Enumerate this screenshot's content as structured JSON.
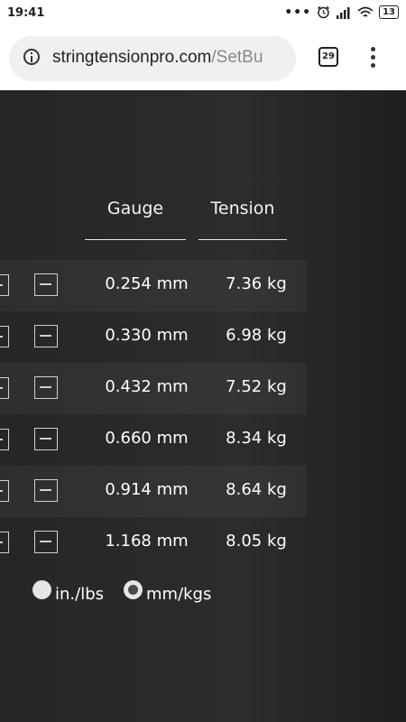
{
  "status_bar": {
    "time": "19:41",
    "battery": "13"
  },
  "browser": {
    "url_domain": "stringtensionpro.com",
    "url_path": "/SetBu",
    "tabs_count": "29"
  },
  "table": {
    "headers": {
      "gauge": "Gauge",
      "tension": "Tension"
    },
    "rows": [
      {
        "gauge": "0.254 mm",
        "tension": "7.36 kg"
      },
      {
        "gauge": "0.330 mm",
        "tension": "6.98 kg"
      },
      {
        "gauge": "0.432 mm",
        "tension": "7.52 kg"
      },
      {
        "gauge": "0.660 mm",
        "tension": "8.34 kg"
      },
      {
        "gauge": "0.914 mm",
        "tension": "8.64 kg"
      },
      {
        "gauge": "1.168 mm",
        "tension": "8.05 kg"
      }
    ]
  },
  "units": {
    "options": [
      {
        "label": "in./lbs",
        "selected": false
      },
      {
        "label": "mm/kgs",
        "selected": true
      }
    ]
  }
}
